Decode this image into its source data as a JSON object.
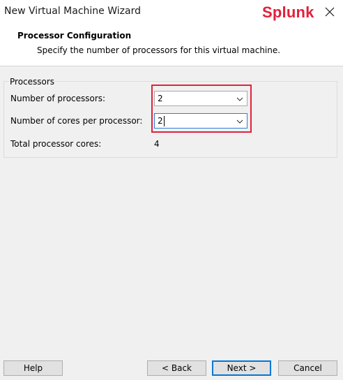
{
  "window": {
    "title": "New Virtual Machine Wizard",
    "brand": "Splunk",
    "close_icon": "close-icon",
    "colors": {
      "brand": "#e3203b",
      "highlight": "#e3203b",
      "focus": "#0078d7"
    }
  },
  "header": {
    "title": "Processor Configuration",
    "subtitle": "Specify the number of processors for this virtual machine."
  },
  "processors": {
    "group_label": "Processors",
    "num_processors_label": "Number of processors:",
    "num_processors_value": "2",
    "cores_label": "Number of cores per processor:",
    "cores_value": "2",
    "total_label": "Total processor cores:",
    "total_value": "4"
  },
  "buttons": {
    "help": "Help",
    "back": "< Back",
    "next": "Next >",
    "cancel": "Cancel"
  }
}
